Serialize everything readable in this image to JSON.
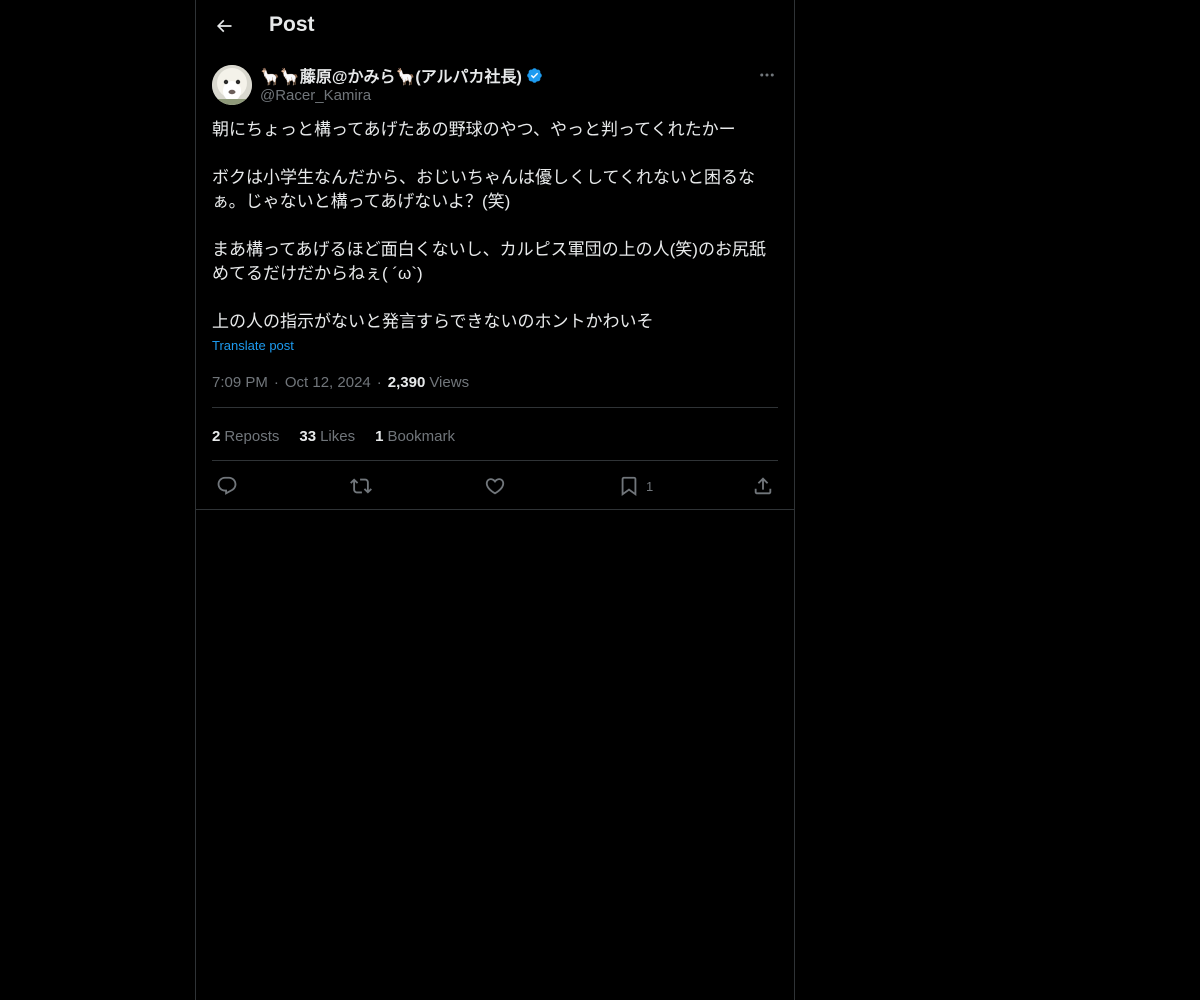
{
  "header": {
    "title": "Post",
    "back_icon": "arrow-left-icon"
  },
  "post": {
    "author": {
      "display_name": "🦙🦙藤原@かみら🦙(アルパカ社長)",
      "handle": "@Racer_Kamira",
      "verified": true,
      "avatar_icon": "alpaca-avatar"
    },
    "paragraphs": [
      "朝にちょっと構ってあげたあの野球のやつ、やっと判ってくれたかー",
      "ボクは小学生なんだから、おじいちゃんは優しくしてくれないと困るな\nぁ。じゃないと構ってあげないよ？(笑)",
      "まあ構ってあげるほど面白くないし、カルピス軍団の上の人(笑)のお尻舐\nめてるだけだからねぇ( ´ω`)",
      "上の人の指示がないと発言すらできないのホントかわいそ"
    ],
    "translate_label": "Translate post",
    "time": "7:09 PM",
    "date": "Oct 12, 2024",
    "views_count": "2,390",
    "views_label": "Views",
    "separator": "·"
  },
  "stats": {
    "reposts_count": "2",
    "reposts_label": "Reposts",
    "likes_count": "33",
    "likes_label": "Likes",
    "bookmarks_count": "1",
    "bookmarks_label": "Bookmark"
  },
  "actions": {
    "reply_icon": "reply-icon",
    "repost_icon": "repost-icon",
    "like_icon": "heart-icon",
    "bookmark_icon": "bookmark-icon",
    "bookmark_count": "1",
    "share_icon": "share-icon"
  },
  "colors": {
    "background": "#000000",
    "text": "#e7e9ea",
    "secondary": "#71767b",
    "accent": "#1d9bf0",
    "border": "#2f3336"
  }
}
